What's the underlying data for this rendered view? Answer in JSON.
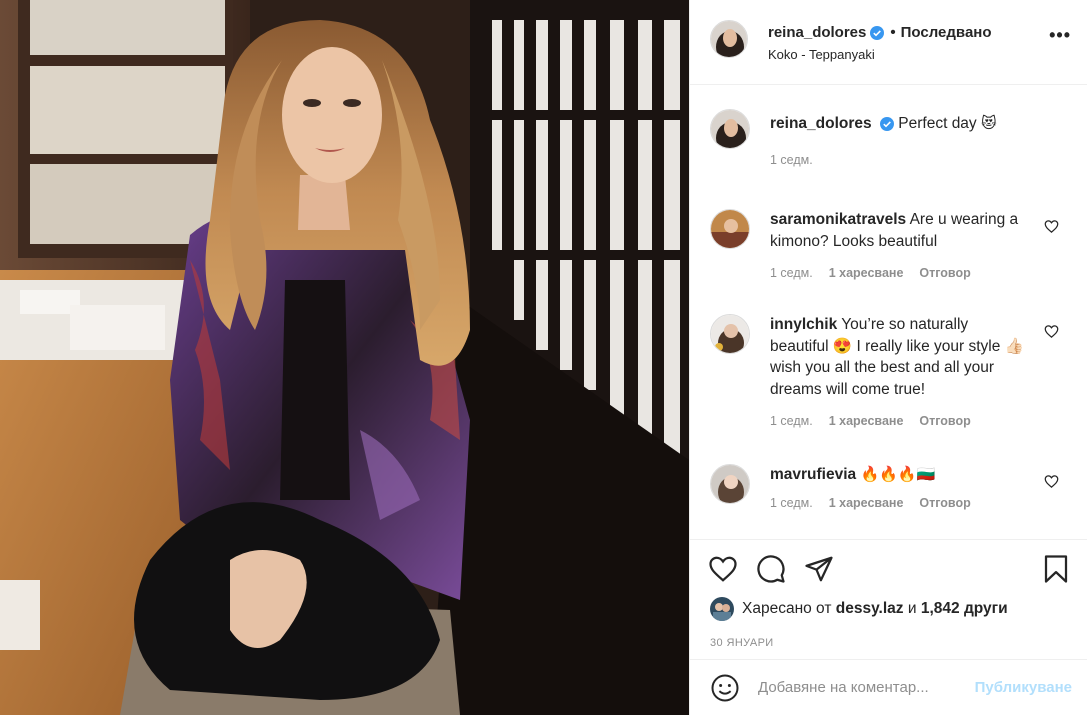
{
  "post": {
    "username": "reina_dolores",
    "follow_label": "Последвано",
    "location": "Koko - Teppanyaki",
    "more_icon": "more-options-icon"
  },
  "caption": {
    "username": "reina_dolores",
    "text": "Perfect day",
    "emoji": "😻",
    "time": "1 седм."
  },
  "comments": [
    {
      "username": "saramonikatravels",
      "text": "Are u wearing a kimono? Looks beautiful",
      "time": "1 седм.",
      "likes": "1 харесване",
      "reply": "Отговор"
    },
    {
      "username": "innylchik",
      "text": "You’re so naturally beautiful 😍 I really like your style 👍🏻 wish you all the best and all your dreams will come true!",
      "time": "1 седм.",
      "likes": "1 харесване",
      "reply": "Отговор"
    },
    {
      "username": "mavrufievia",
      "text": "🔥🔥🔥🇧🇬",
      "time": "1 седм.",
      "likes": "1 харесване",
      "reply": "Отговор"
    }
  ],
  "likes": {
    "prefix": "Харесано от",
    "user": "dessy.laz",
    "conj": "и",
    "count": "1,842 други"
  },
  "date": "30 ЯНУАРИ",
  "add_comment": {
    "placeholder": "Добавяне на коментар...",
    "post_label": "Публикуване"
  },
  "colors": {
    "verified": "#3897f0",
    "post_disabled": "#b2dffc",
    "secondary_text": "#8e8e8e"
  }
}
